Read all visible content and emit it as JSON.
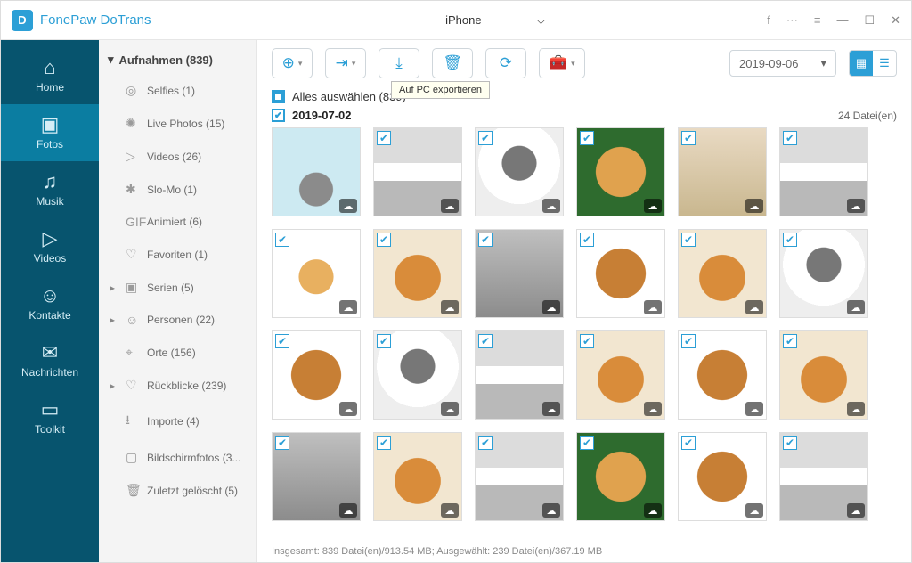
{
  "app": {
    "name": "FonePaw DoTrans"
  },
  "device": {
    "type_icon": "apple-icon",
    "name": "iPhone"
  },
  "nav": [
    {
      "id": "home",
      "label": "Home",
      "icon": "⌂"
    },
    {
      "id": "fotos",
      "label": "Fotos",
      "icon": "▣",
      "active": true
    },
    {
      "id": "musik",
      "label": "Musik",
      "icon": "♫"
    },
    {
      "id": "videos",
      "label": "Videos",
      "icon": "▷"
    },
    {
      "id": "kontakte",
      "label": "Kontakte",
      "icon": "☺"
    },
    {
      "id": "nachrichten",
      "label": "Nachrichten",
      "icon": "✉"
    },
    {
      "id": "toolkit",
      "label": "Toolkit",
      "icon": "▭"
    }
  ],
  "sidebar": {
    "head": "Aufnahmen (839)",
    "items": [
      {
        "icon": "◎",
        "label": "Selfies (1)"
      },
      {
        "icon": "✺",
        "label": "Live Photos (15)"
      },
      {
        "icon": "▷",
        "label": "Videos (26)"
      },
      {
        "icon": "✱",
        "label": "Slo-Mo (1)"
      },
      {
        "icon": "GIF",
        "label": "Animiert (6)"
      },
      {
        "icon": "♡",
        "label": "Favoriten (1)"
      },
      {
        "icon": "▣",
        "label": "Serien (5)",
        "chev": true
      },
      {
        "icon": "☺",
        "label": "Personen (22)",
        "chev": true
      },
      {
        "icon": "⌖",
        "label": "Orte (156)"
      },
      {
        "icon": "♡",
        "label": "Rückblicke (239)",
        "chev": true
      },
      {
        "icon": "⭳",
        "label": "Importe (4)"
      },
      {
        "icon": "▢",
        "label": "Bildschirmfotos (3..."
      },
      {
        "icon": "🗑",
        "label": "Zuletzt gelöscht (5)"
      }
    ]
  },
  "toolbar": {
    "tooltip": "Auf PC exportieren",
    "date": "2019-09-06"
  },
  "main": {
    "select_all": "Alles auswählen (839)",
    "group_date": "2019-07-02",
    "group_count": "24 Datei(en)"
  },
  "thumbs": [
    [
      "cat1",
      "cat2",
      "cat3",
      "dog1",
      "room",
      "cat2"
    ],
    [
      "stk",
      "dog2",
      "gry",
      "dog3",
      "dog2",
      "cat3"
    ],
    [
      "dog3",
      "cat3",
      "cat2",
      "dog2",
      "dog3",
      "dog2"
    ],
    [
      "gry",
      "dog2",
      "cat2",
      "dog1",
      "dog3",
      "cat2"
    ]
  ],
  "nochk": [
    [
      0,
      0
    ]
  ],
  "status": "Insgesamt: 839 Datei(en)/913.54 MB; Ausgewählt: 239 Datei(en)/367.19 MB"
}
